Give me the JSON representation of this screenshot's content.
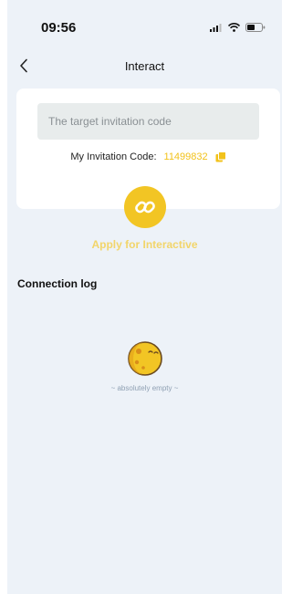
{
  "status_bar": {
    "time": "09:56",
    "icons": [
      "signal-icon",
      "wifi-icon",
      "battery-icon"
    ]
  },
  "nav": {
    "back_icon": "chevron-left-icon",
    "title": "Interact"
  },
  "invite": {
    "input_value": "",
    "input_placeholder": "The target invitation code",
    "my_code_label": "My Invitation Code:",
    "my_code_value": "11499832",
    "copy_icon": "copy-icon"
  },
  "apply": {
    "icon": "link-icon",
    "label": "Apply for Interactive"
  },
  "connection_log": {
    "title": "Connection log",
    "empty_icon": "moon-icon",
    "empty_text": "~ absolutely empty ~"
  },
  "colors": {
    "background": "#edf2f8",
    "card": "#ffffff",
    "accent": "#f2c524",
    "apply_label": "#f2d56a",
    "muted": "#8fa0b3"
  }
}
